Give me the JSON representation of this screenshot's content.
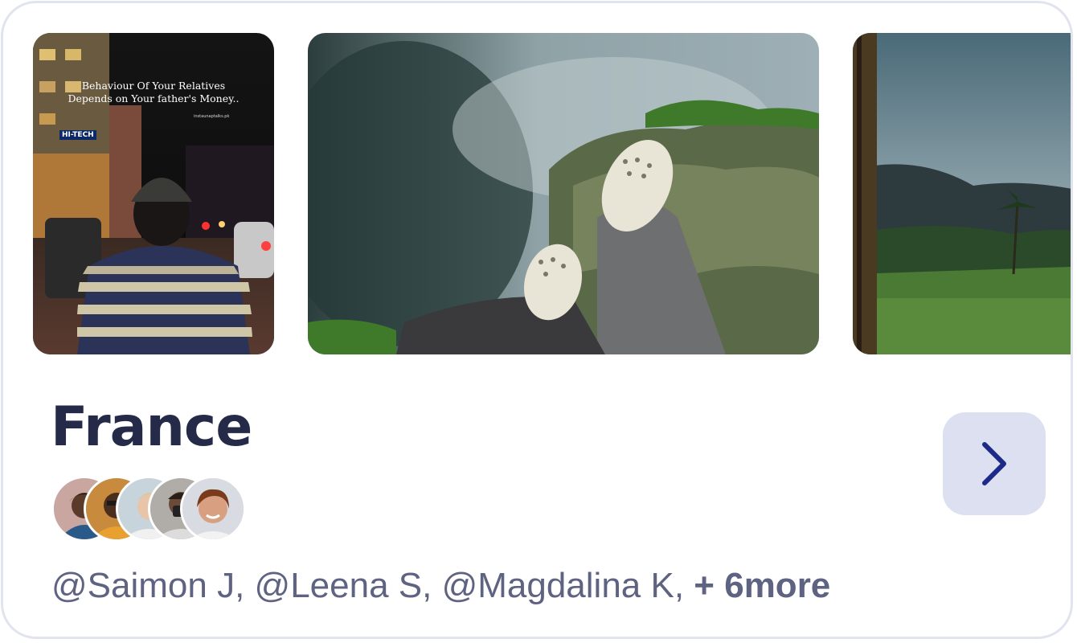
{
  "card": {
    "title": "France",
    "photos": [
      {
        "name": "night-street-photo",
        "overlay_line1": "Behaviour Of Your Relatives",
        "overlay_line2": "Depends on Your father's Money..",
        "shop_sign": "HI-TECH",
        "credit": "instaunaptalks.pk"
      },
      {
        "name": "misty-cliff-feet-photo"
      },
      {
        "name": "stormy-hills-photo"
      }
    ],
    "participants": {
      "names": "@Saimon J, @Leena S, @Magdalina K, ",
      "more_label": "+ 6more",
      "avatar_count": 5
    },
    "next_icon": "chevron-right-icon",
    "colors": {
      "title": "#242a48",
      "text": "#5f6382",
      "button_bg": "#dde0f0",
      "button_icon": "#1d2a8a",
      "border": "#e1e4ef"
    }
  }
}
